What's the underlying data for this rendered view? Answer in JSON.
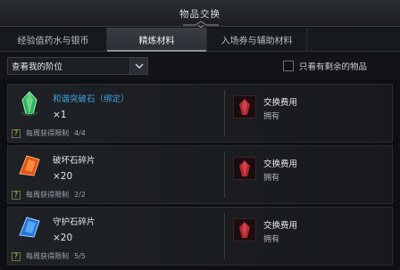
{
  "window": {
    "title": "物品交换"
  },
  "tabs": [
    {
      "label": "经验值药水与银币"
    },
    {
      "label": "精炼材料",
      "active": true
    },
    {
      "label": "入场券与辅助材料"
    }
  ],
  "filter": {
    "dropdown_value": "查看我的阶位",
    "checkbox_label": "只看有剩余的物品",
    "checkbox_checked": false
  },
  "items": [
    {
      "name": "和谐突破石（绑定）",
      "qty": "×1",
      "weekly_label": "每周获得限制",
      "weekly_value": "4/4",
      "cost_label": "交换费用",
      "owned_label": "拥有",
      "icon": "green-crystal-icon"
    },
    {
      "name": "破坏石碎片",
      "qty": "×20",
      "weekly_label": "每周获得限制",
      "weekly_value": "2/2",
      "cost_label": "交换费用",
      "owned_label": "拥有",
      "icon": "red-shard-icon"
    },
    {
      "name": "守护石碎片",
      "qty": "×20",
      "weekly_label": "每周获得限制",
      "weekly_value": "5/5",
      "cost_label": "交换费用",
      "owned_label": "拥有",
      "icon": "blue-shard-icon"
    }
  ],
  "colors": {
    "accent_blue": "#3fa3e8",
    "background": "#0d0f12"
  }
}
